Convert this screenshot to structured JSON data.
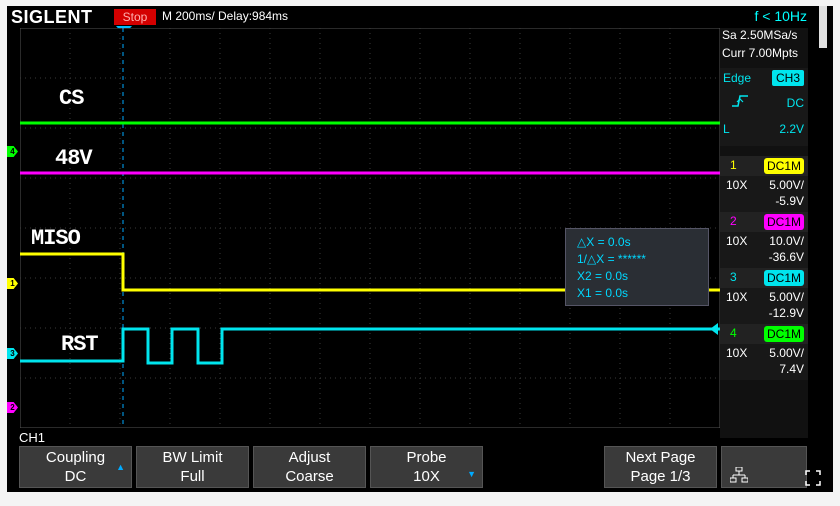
{
  "header": {
    "brand": "SIGLENT",
    "run_state": "Stop",
    "timebase": "M 200ms/  Delay:984ms",
    "frequency": "f < 10Hz"
  },
  "acquisition": {
    "sample_rate": "Sa 2.50MSa/s",
    "memory_depth": "Curr 7.00Mpts"
  },
  "trigger": {
    "type": "Edge",
    "source": "CH3",
    "coupling": "DC",
    "mode_letter": "L",
    "level": "2.2V",
    "slope_icon": "rising-edge-icon"
  },
  "channels": [
    {
      "num": "1",
      "coupling": "DC1M",
      "probe": "10X",
      "scale": "5.00V/",
      "offset": "-5.9V",
      "color": "#ffff00"
    },
    {
      "num": "2",
      "coupling": "DC1M",
      "probe": "10X",
      "scale": "10.0V/",
      "offset": "-36.6V",
      "color": "#ff00ff"
    },
    {
      "num": "3",
      "coupling": "DC1M",
      "probe": "10X",
      "scale": "5.00V/",
      "offset": "-12.9V",
      "color": "#00e5ee"
    },
    {
      "num": "4",
      "coupling": "DC1M",
      "probe": "10X",
      "scale": "5.00V/",
      "offset": "7.4V",
      "color": "#00ff00"
    }
  ],
  "cursors": {
    "delta_x": "△X = 0.0s",
    "inv_delta_x": "1/△X = ******",
    "x2": "X2 = 0.0s",
    "x1": "X1 = 0.0s"
  },
  "annotations": {
    "cs": "CS",
    "v48": "48V",
    "miso": "MISO",
    "rst": "RST"
  },
  "markers": {
    "ch1": "1",
    "ch2": "2",
    "ch3": "3",
    "ch4": "4"
  },
  "menu": {
    "title": "CH1",
    "softkeys": [
      {
        "l1": "Coupling",
        "l2": "DC"
      },
      {
        "l1": "BW Limit",
        "l2": "Full"
      },
      {
        "l1": "Adjust",
        "l2": "Coarse"
      },
      {
        "l1": "Probe",
        "l2": "10X"
      },
      {
        "l1": "Next Page",
        "l2": "Page 1/3"
      }
    ]
  },
  "icons": {
    "network": "network-icon",
    "fullscreen": "fullscreen-icon"
  }
}
